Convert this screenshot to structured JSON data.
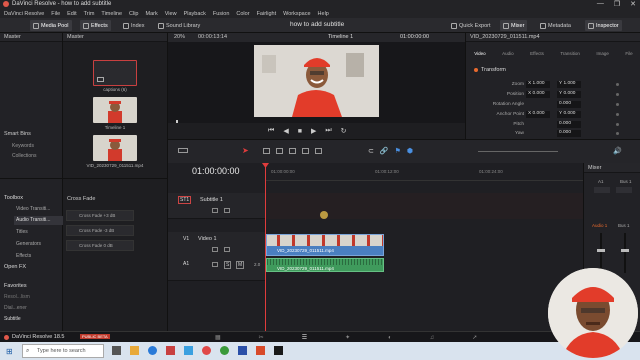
{
  "window": {
    "app_title": "DaVinci Resolve - how to add subtitle",
    "controls": [
      "—",
      "❐",
      "✕"
    ]
  },
  "menu": [
    "DaVinci Resolve",
    "File",
    "Edit",
    "Trim",
    "Timeline",
    "Clip",
    "Mark",
    "View",
    "Playback",
    "Fusion",
    "Color",
    "Fairlight",
    "Workspace",
    "Help"
  ],
  "toolbar": {
    "media_pool": "Media Pool",
    "effects": "Effects",
    "index": "Index",
    "sound_library": "Sound Library",
    "project_name": "how to add subtitle",
    "quick_export": "Quick Export",
    "mixer": "Mixer",
    "metadata": "Metadata",
    "inspector": "Inspector"
  },
  "left_panel": {
    "master": "Master",
    "smart_bins": "Smart Bins",
    "keywords": "Keywords",
    "collections": "Collections"
  },
  "media_pool": {
    "master": "Master",
    "clips": [
      {
        "label": "captions (6)"
      },
      {
        "label": "Timeline 1"
      },
      {
        "label": "VID_20230729_011511.mp4"
      }
    ]
  },
  "viewer": {
    "zoom": "20%",
    "source_timecode": "00:00:13:14",
    "timeline_name": "Timeline 1",
    "timecode": "01:00:00:00"
  },
  "inspector": {
    "clip_name": "VID_20230729_011511.mp4",
    "tabs": [
      "Video",
      "Audio",
      "Effects",
      "Transition",
      "Image",
      "File"
    ],
    "section": "Transform",
    "rows": [
      {
        "label": "Zoom",
        "x": "X  1.000",
        "y": "Y  1.000"
      },
      {
        "label": "Position",
        "x": "X  0.000",
        "y": "Y  0.000"
      },
      {
        "label": "Rotation Angle",
        "x": "",
        "y": "0.000"
      },
      {
        "label": "Anchor Point",
        "x": "X  0.000",
        "y": "Y  0.000"
      },
      {
        "label": "Pitch",
        "x": "",
        "y": "0.000"
      },
      {
        "label": "Yaw",
        "x": "",
        "y": "0.000"
      }
    ]
  },
  "toolbox": {
    "items": [
      "Toolbox",
      "Video Transiti...",
      "Audio Transiti...",
      "Titles",
      "Generators",
      "Effects",
      "Open FX"
    ],
    "favorites": "Favorites",
    "fav_items": [
      "Resol...lism",
      "Dial...ener",
      "Subtitle"
    ]
  },
  "effects_panel": {
    "header": "Cross Fade",
    "items": [
      "Cross Fade +3 dB",
      "Cross Fade -3 dB",
      "Cross Fade 0 dB"
    ]
  },
  "timeline": {
    "timecode": "01:00:00:00",
    "ruler": [
      "01:00:00:00",
      "01:00:12:00",
      "01:00:24:00"
    ],
    "tracks": {
      "st1": {
        "badge": "ST1",
        "name": "Subtitle 1"
      },
      "v1": {
        "badge": "V1",
        "name": "Video 1",
        "clip": "VID_20230729_011511.mp4"
      },
      "a1": {
        "badge": "A1",
        "level": "2.0",
        "clip": "VID_20230729_011511.mp4"
      }
    }
  },
  "mixer": {
    "title": "Mixer",
    "ch1": "A1",
    "ch2": "Bus 1",
    "label1": "Audio 1",
    "label2": "Bus 1"
  },
  "pagebar": {
    "title": "DaVinci Resolve 18.5",
    "badge": "PUBLIC BETA"
  },
  "taskbar": {
    "search_placeholder": "Type here to search"
  },
  "colors": {
    "accent": "#e86a2e",
    "playhead": "#e03c3c",
    "video_clip": "#4a7fc0",
    "audio_clip": "#3f9a5c",
    "subtitle_track": "#8a3a4a"
  }
}
